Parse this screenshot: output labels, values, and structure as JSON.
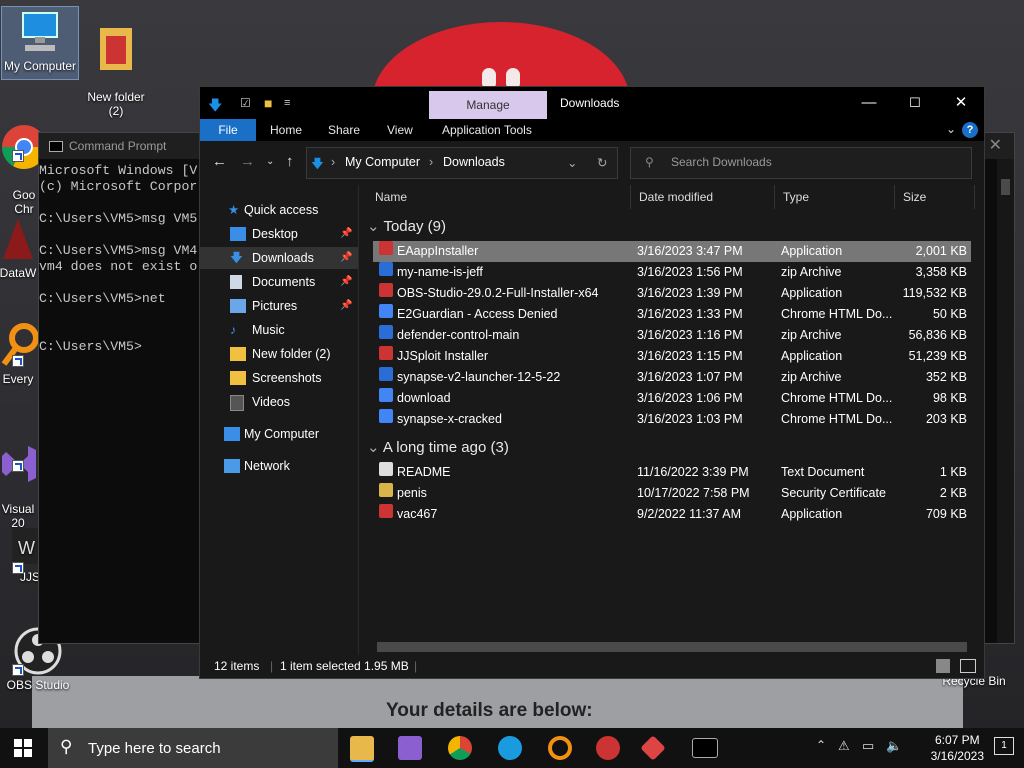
{
  "desktop": {
    "icons": [
      {
        "label": "My Computer"
      },
      {
        "label": "New folder\n(2)"
      },
      {
        "label": "Goo\nChr"
      },
      {
        "label": "DataW"
      },
      {
        "label": "Every"
      },
      {
        "label": "Visual\n20"
      },
      {
        "label": "JJS"
      },
      {
        "label": "OBS Studio"
      },
      {
        "label": "Recycle Bin"
      }
    ],
    "web_text": "Your details are below:"
  },
  "cmd": {
    "title": "Command Prompt",
    "lines": "Microsoft Windows [V\n(c) Microsoft Corpor\n\nC:\\Users\\VM5>msg VM5\n\nC:\\Users\\VM5>msg VM4\nvm4 does not exist o\n\nC:\\Users\\VM5>net\n\n\nC:\\Users\\VM5>"
  },
  "explorer": {
    "title": "Downloads",
    "manage_label": "Manage",
    "tabs": {
      "file": "File",
      "home": "Home",
      "share": "Share",
      "view": "View",
      "app_tools": "Application Tools"
    },
    "breadcrumb": {
      "root": "My Computer",
      "current": "Downloads"
    },
    "search_placeholder": "Search Downloads",
    "nav": {
      "quick_access": "Quick access",
      "items": [
        "Desktop",
        "Downloads",
        "Documents",
        "Pictures",
        "Music",
        "New folder (2)",
        "Screenshots",
        "Videos"
      ],
      "my_computer": "My Computer",
      "network": "Network"
    },
    "columns": {
      "name": "Name",
      "date": "Date modified",
      "type": "Type",
      "size": "Size"
    },
    "groups": {
      "today": "Today (9)",
      "long_ago": "A long time ago (3)"
    },
    "today_rows": [
      {
        "name": "EAappInstaller",
        "date": "3/16/2023 3:47 PM",
        "type": "Application",
        "size": "2,001 KB"
      },
      {
        "name": "my-name-is-jeff",
        "date": "3/16/2023 1:56 PM",
        "type": "zip Archive",
        "size": "3,358 KB"
      },
      {
        "name": "OBS-Studio-29.0.2-Full-Installer-x64",
        "date": "3/16/2023 1:39 PM",
        "type": "Application",
        "size": "119,532 KB"
      },
      {
        "name": "E2Guardian - Access Denied",
        "date": "3/16/2023 1:33 PM",
        "type": "Chrome HTML Do...",
        "size": "50 KB"
      },
      {
        "name": "defender-control-main",
        "date": "3/16/2023 1:16 PM",
        "type": "zip Archive",
        "size": "56,836 KB"
      },
      {
        "name": "JJSploit Installer",
        "date": "3/16/2023 1:15 PM",
        "type": "Application",
        "size": "51,239 KB"
      },
      {
        "name": "synapse-v2-launcher-12-5-22",
        "date": "3/16/2023 1:07 PM",
        "type": "zip Archive",
        "size": "352 KB"
      },
      {
        "name": "download",
        "date": "3/16/2023 1:06 PM",
        "type": "Chrome HTML Do...",
        "size": "98 KB"
      },
      {
        "name": "synapse-x-cracked",
        "date": "3/16/2023 1:03 PM",
        "type": "Chrome HTML Do...",
        "size": "203 KB"
      }
    ],
    "old_rows": [
      {
        "name": "README",
        "date": "11/16/2022 3:39 PM",
        "type": "Text Document",
        "size": "1 KB"
      },
      {
        "name": "penis",
        "date": "10/17/2022 7:58 PM",
        "type": "Security Certificate",
        "size": "2 KB"
      },
      {
        "name": "vac467",
        "date": "9/2/2022 11:37 AM",
        "type": "Application",
        "size": "709 KB"
      }
    ],
    "status": {
      "items": "12 items",
      "selected": "1 item selected  1.95 MB"
    }
  },
  "taskbar": {
    "search_placeholder": "Type here to search",
    "time": "6:07 PM",
    "date": "3/16/2023",
    "notification_count": "1"
  },
  "colors": {
    "accent": "#1a6fc6",
    "manage": "#d8c8ec",
    "selection": "#777777"
  }
}
